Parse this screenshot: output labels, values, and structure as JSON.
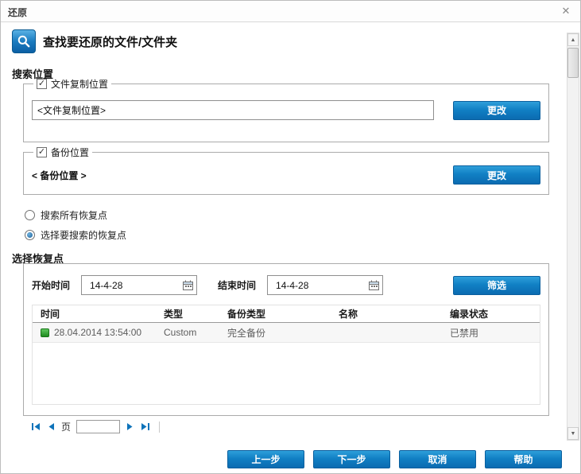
{
  "colors": {
    "accent_blue": "#0e73ba",
    "button_border": "#0a5f9e",
    "status_green": "#2e9e2e"
  },
  "icons": {
    "close": "✕",
    "check": "✓",
    "search": "magnifier",
    "calendar": "calendar-grid",
    "status_ok": "green-square",
    "scroll_up": "▲",
    "scroll_down": "▼"
  },
  "dialog": {
    "title": "还原",
    "header": "查找要还原的文件/文件夹"
  },
  "search_location": {
    "section_label": "搜索位置",
    "file_copy": {
      "checkbox_label": "文件复制位置",
      "checked": true,
      "input_value": "<文件复制位置>",
      "change_button": "更改"
    },
    "backup": {
      "checkbox_label": "备份位置",
      "checked": true,
      "location_text": "< 备份位置 >",
      "change_button": "更改"
    },
    "radio_all": "搜索所有恢复点",
    "radio_select": "选择要搜索的恢复点",
    "radio_selected": "选择要搜索的恢复点"
  },
  "recovery_points": {
    "section_label": "选择恢复点",
    "start_time_label": "开始时间",
    "start_time_value": "14-4-28",
    "end_time_label": "结束时间",
    "end_time_value": "14-4-28",
    "filter_button": "筛选",
    "table": {
      "headers": [
        "时间",
        "类型",
        "备份类型",
        "名称",
        "编录状态"
      ],
      "rows": [
        {
          "time": "28.04.2014 13:54:00",
          "type": "Custom",
          "backup_type": "完全备份",
          "name": "",
          "catalog_status": "已禁用"
        }
      ]
    },
    "pagination": {
      "page_label": "页",
      "page_value": ""
    }
  },
  "footer": {
    "prev_button": "上一步",
    "next_button": "下一步",
    "cancel_button": "取消",
    "help_button": "帮助"
  }
}
